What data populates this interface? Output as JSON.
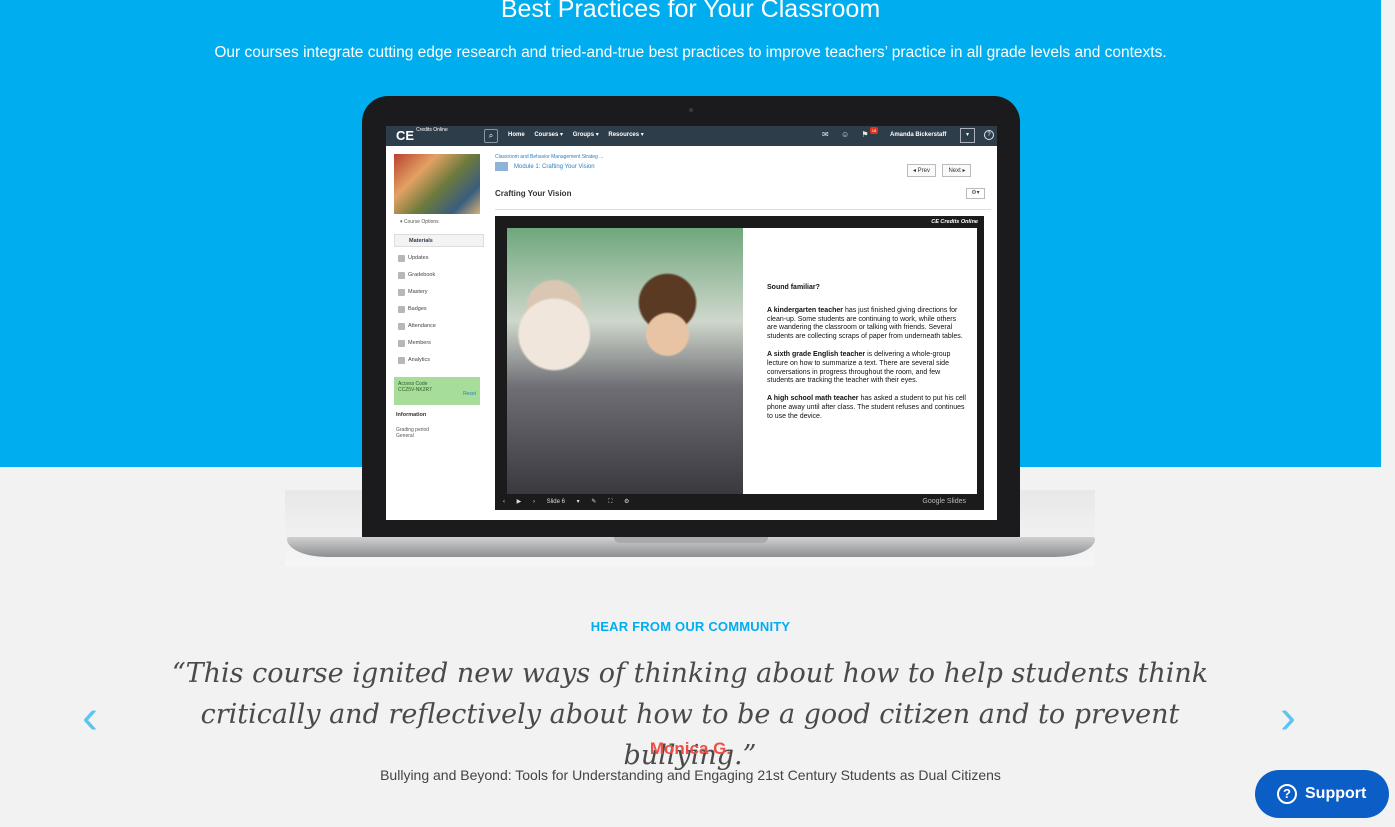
{
  "hero": {
    "title": "Best Practices for Your Classroom",
    "subtitle": "Our courses integrate cutting edge research and tried-and-true best practices to improve teachers’ practice in all grade levels and contexts."
  },
  "laptop_screen": {
    "logo": "CE",
    "logo_sub": "Credits Online",
    "nav": [
      "Home",
      "Courses ▾",
      "Groups ▾",
      "Resources ▾"
    ],
    "badge": "18",
    "user": "Amanda Bickerstaff",
    "sidebar": {
      "course_options": "▾ Course Options",
      "active": "Materials",
      "items": [
        "Updates",
        "Gradebook",
        "Mastery",
        "Badges",
        "Attendance",
        "Members",
        "Analytics"
      ],
      "access_label": "Access Code",
      "access_code": "CCZ5V-NK2R7",
      "reset": "Reset",
      "info_heading": "Information",
      "info_text1": "Grading period",
      "info_text2": "General"
    },
    "breadcrumb": "Classroom and Behavior Management Strateg ...",
    "module": "Module 1: Crafting Your Vision",
    "prev": "◂ Prev",
    "next": "Next ▸",
    "page_title": "Crafting Your Vision",
    "slide": {
      "brand": "CE Credits Online",
      "question": "Sound familiar?",
      "p1_bold": "A kindergarten teacher",
      "p1": " has just finished giving directions for clean-up. Some students are continuing to work, while others are wandering the classroom or talking with friends. Several students are collecting scraps of paper from underneath tables.",
      "p2_bold": "A sixth grade English teacher",
      "p2": " is delivering a whole-group lecture on how to summarize a text. There are several side conversations in progress throughout the room, and few students are tracking the teacher with their eyes.",
      "p3_bold": "A high school math teacher",
      "p3": " has asked a student to put his cell phone away until after class. The student refuses and continues to use the device.",
      "slide_label": "Slide 6",
      "google": "Google Slides"
    }
  },
  "community": {
    "heading": "HEAR FROM OUR COMMUNITY",
    "quote": "“This course ignited new ways of thinking about how to help students think critically and reflectively about how to be a good citizen and to prevent bullying.”",
    "author": "Monica G.",
    "course": "Bullying and Beyond: Tools for Understanding and Engaging 21st Century Students as Dual Citizens",
    "prev_icon": "chevron-left-icon",
    "next_icon": "chevron-right-icon"
  },
  "support": {
    "label": "Support",
    "icon": "question-circle-icon"
  },
  "colors": {
    "hero_bg": "#00aeef",
    "accent_red": "#f04e45",
    "support_bg": "#0b5ec6"
  }
}
